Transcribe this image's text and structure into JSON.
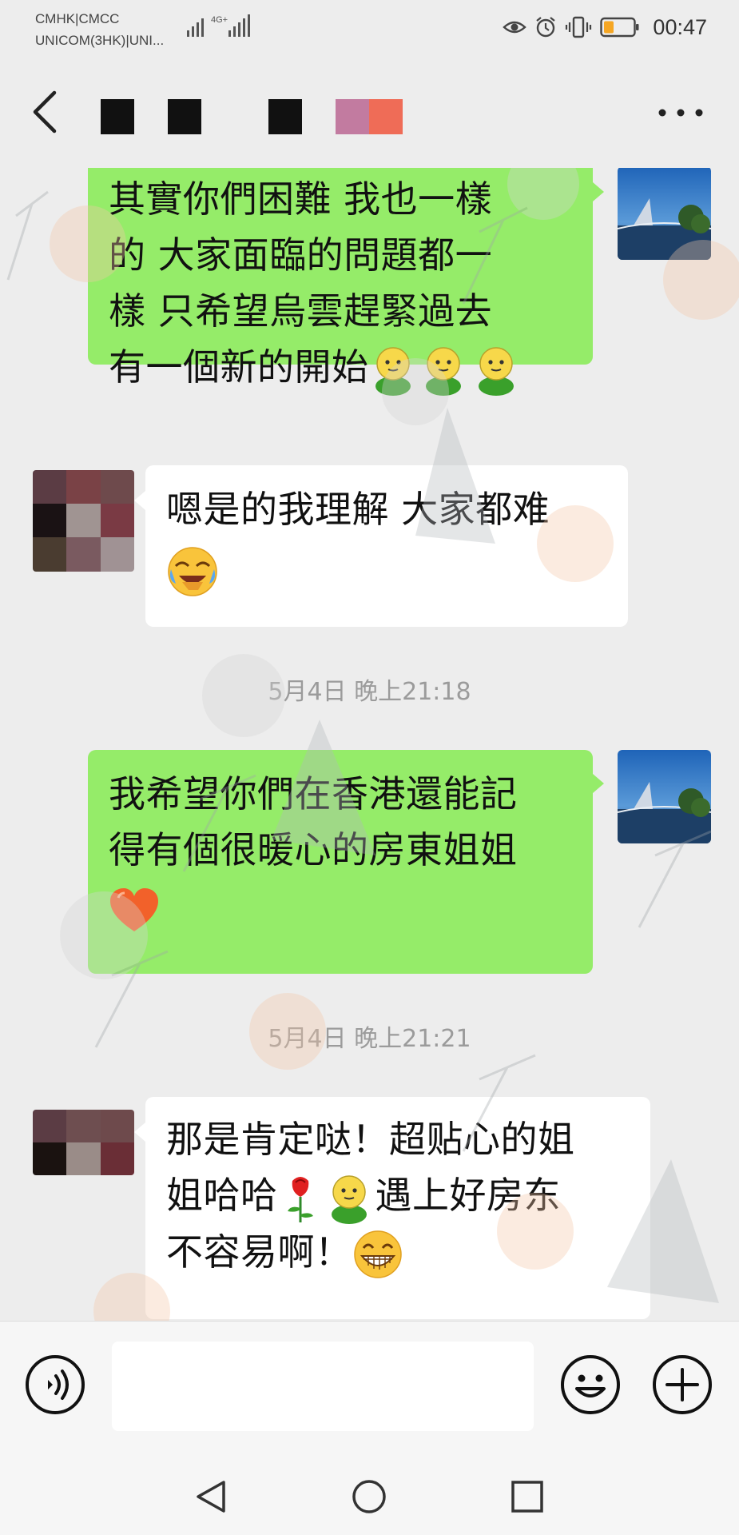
{
  "status_bar": {
    "carrier_line1": "CMHK|CMCC",
    "carrier_line2": "UNICOM(3HK)|UNI...",
    "network": "4G+",
    "time": "00:47",
    "battery_color": "#f5a623",
    "icons": [
      "eye-icon",
      "alarm-icon",
      "vibrate-icon",
      "battery-icon"
    ]
  },
  "header": {
    "back_icon": "chevron-left-icon",
    "more_icon": "more-dots-icon",
    "title_block_colors": [
      "#111111",
      "#111111",
      "#111111",
      "#c27ba0",
      "#ef6c57"
    ]
  },
  "messages": [
    {
      "sender": "self",
      "lines": [
        "其實你們困難 我也一樣",
        "的 大家面臨的問題都一",
        "樣 只希望烏雲趕緊過去",
        "有一個新的開始"
      ],
      "trailing_emoji": [
        "green-figure-emoji",
        "green-figure-emoji",
        "green-figure-emoji"
      ]
    },
    {
      "sender": "other",
      "lines": [
        "嗯是的我理解 大家都难"
      ],
      "trailing_emoji": [
        "laugh-cry-emoji"
      ]
    },
    {
      "type": "timestamp",
      "text": "5月4日 晚上21:18"
    },
    {
      "sender": "self",
      "lines": [
        "我希望你們在香港還能記",
        "得有個很暖心的房東姐姐"
      ],
      "trailing_emoji": [
        "heart-emoji"
      ]
    },
    {
      "type": "timestamp",
      "text": "5月4日 晚上21:21"
    },
    {
      "sender": "other",
      "lines": [
        "那是肯定哒！超贴心的姐",
        "姐哈哈",
        "遇上好房东",
        "不容易啊！"
      ],
      "trailing_emoji": [
        "rose-emoji",
        "green-figure-emoji",
        "grin-emoji"
      ]
    }
  ],
  "input_bar": {
    "voice_icon": "voice-icon",
    "emoji_icon": "smiley-icon",
    "plus_icon": "plus-icon",
    "text_value": ""
  },
  "nav_bar": {
    "icons": [
      "nav-back-icon",
      "nav-home-icon",
      "nav-recents-icon"
    ]
  },
  "colors": {
    "background": "#ededed",
    "self_bubble": "#95ec69",
    "other_bubble": "#ffffff",
    "timestamp_text": "#9b9b9b"
  }
}
